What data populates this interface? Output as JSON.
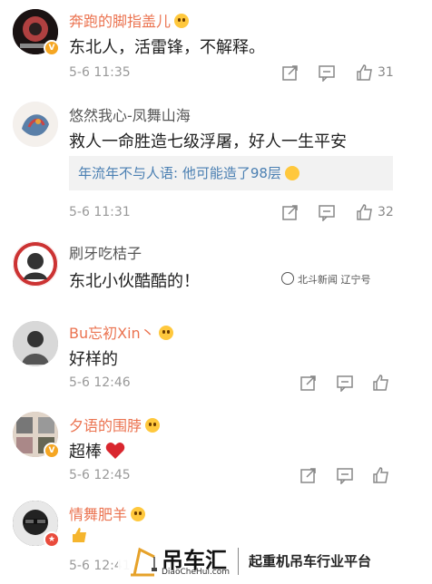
{
  "comments": [
    {
      "name": "奔跑的脚指盖儿",
      "text": "东北人，活雷锋，不解释。",
      "time": "5-6 11:35",
      "likes": "31"
    },
    {
      "name": "悠然我心-凤舞山海",
      "text": "救人一命胜造七级浮屠，好人一生平安",
      "reply": "年流年不与人语: 他可能造了98层",
      "time": "5-6 11:31",
      "likes": "32"
    },
    {
      "name": "刷牙吃桔子",
      "text": "东北小伙酷酷的！"
    },
    {
      "name": "Bu忘初Xin丶",
      "text": "好样的",
      "time": "5-6 12:46"
    },
    {
      "name": "夕语的围脖",
      "text": "超棒",
      "time": "5-6 12:45"
    },
    {
      "name": "情舞肥羊",
      "time": "5-6 12:41"
    }
  ],
  "watermark": {
    "wechat_source": "北斗新闻 辽宁号",
    "brand_name": "吊车汇",
    "brand_url": "DiaoCheHui.com",
    "tagline": "起重机吊车行业平台"
  },
  "icons": {
    "share": "share-icon",
    "comment": "comment-icon",
    "like": "thumbs-up-icon",
    "heart": "heart-emoji",
    "verified": "verified-badge"
  },
  "colors": {
    "username": "#eb7350",
    "reply_text": "#4a7fb2",
    "timestamp": "#999999",
    "quote_bg": "#f2f2f2"
  }
}
